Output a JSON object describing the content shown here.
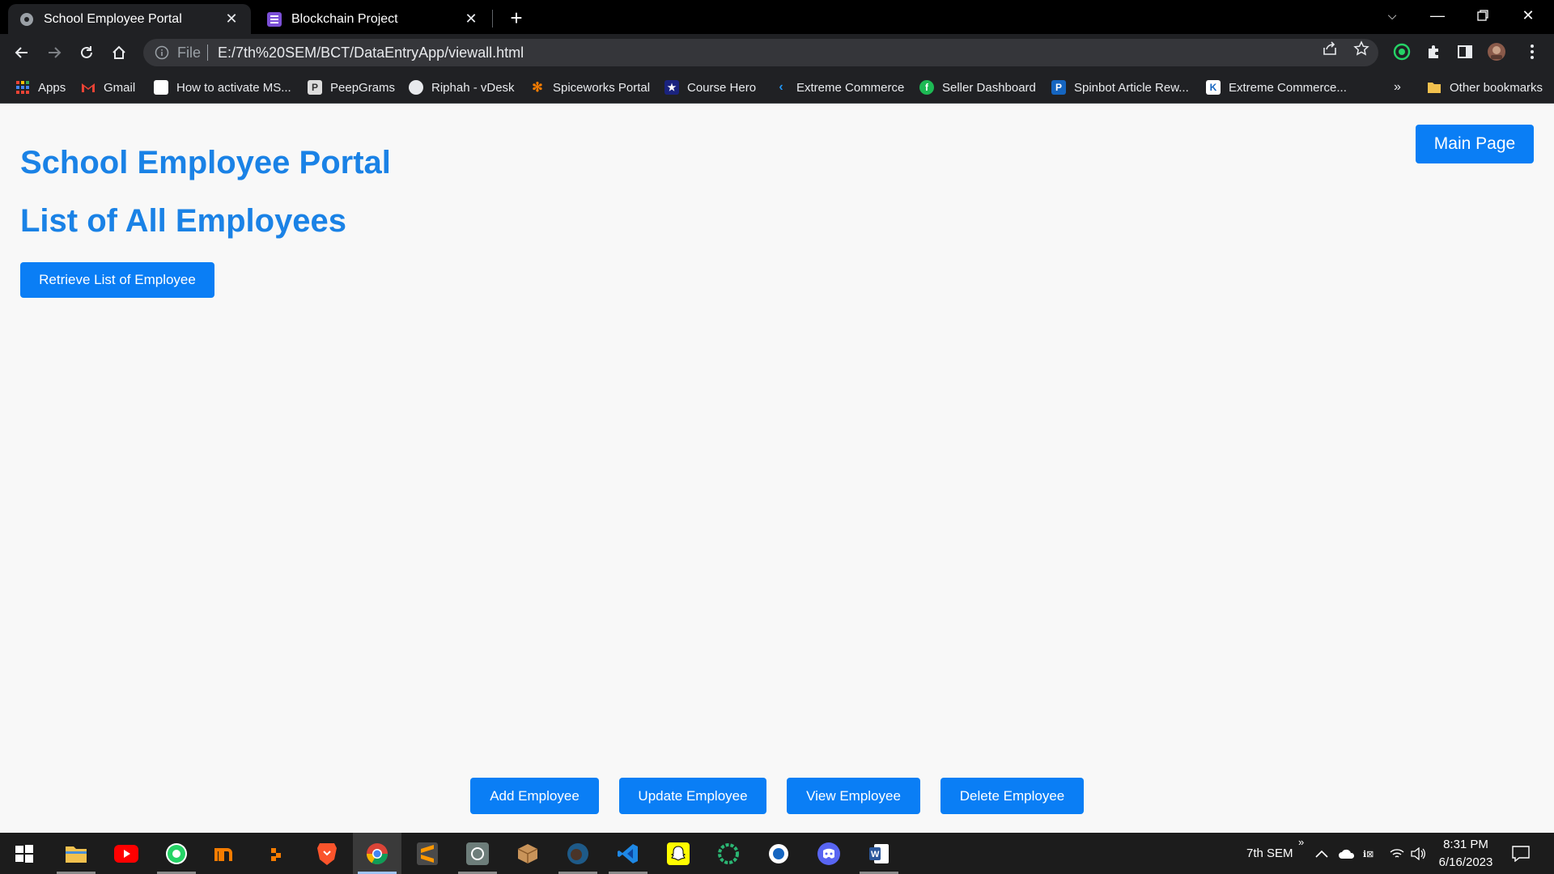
{
  "browser": {
    "tabs": [
      {
        "title": "School Employee Portal",
        "active": true
      },
      {
        "title": "Blockchain Project",
        "active": false
      }
    ],
    "address": {
      "scheme_label": "File",
      "url": "E:/7th%20SEM/BCT/DataEntryApp/viewall.html"
    },
    "bookmarks": [
      {
        "label": "Apps",
        "icon": "apps-grid-icon"
      },
      {
        "label": "Gmail",
        "icon": "gmail-icon"
      },
      {
        "label": "How to activate MS...",
        "icon": "page-icon"
      },
      {
        "label": "PeepGrams",
        "icon": "peepgrams-icon"
      },
      {
        "label": "Riphah - vDesk",
        "icon": "globe-icon"
      },
      {
        "label": "Spiceworks Portal",
        "icon": "spiceworks-icon"
      },
      {
        "label": "Course Hero",
        "icon": "coursehero-icon"
      },
      {
        "label": "Extreme Commerce",
        "icon": "extreme-commerce-icon"
      },
      {
        "label": "Seller Dashboard",
        "icon": "seller-icon"
      },
      {
        "label": "Spinbot Article Rew...",
        "icon": "spinbot-icon"
      },
      {
        "label": "Extreme Commerce...",
        "icon": "extreme-commerce-icon"
      }
    ],
    "overflow_label": "»",
    "other_bookmarks": "Other bookmarks"
  },
  "page": {
    "title": "School Employee Portal",
    "subtitle": "List of All Employees",
    "main_page_button": "Main Page",
    "retrieve_button": "Retrieve List of Employee",
    "footer_buttons": {
      "add": "Add Employee",
      "update": "Update Employee",
      "view": "View Employee",
      "delete": "Delete Employee"
    }
  },
  "taskbar": {
    "folder_label": "7th SEM",
    "chevron": "»",
    "time": "8:31 PM",
    "date": "6/16/2023"
  },
  "colors": {
    "accent": "#0a7ef5",
    "heading": "#1a82e6",
    "page_bg": "#f8f8f8",
    "chrome_dark": "#202124"
  }
}
